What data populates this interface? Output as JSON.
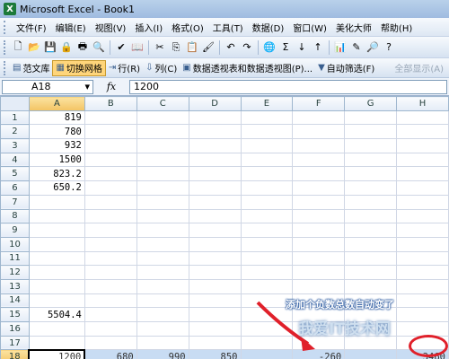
{
  "window": {
    "app_icon": "X",
    "title": "Microsoft Excel - Book1"
  },
  "menu": [
    "文件(F)",
    "编辑(E)",
    "视图(V)",
    "插入(I)",
    "格式(O)",
    "工具(T)",
    "数据(D)",
    "窗口(W)",
    "美化大师",
    "帮助(H)"
  ],
  "toolbar_icons": [
    "new-icon",
    "open-icon",
    "save-icon",
    "permission-icon",
    "print-icon",
    "print-preview-icon",
    "spelling-icon",
    "research-icon",
    "cut-icon",
    "copy-icon",
    "paste-icon",
    "format-painter-icon",
    "undo-icon",
    "redo-icon",
    "hyperlink-icon",
    "autosum-icon",
    "sort-asc-icon",
    "sort-desc-icon",
    "chart-icon",
    "drawing-icon",
    "zoom-icon",
    "help-icon"
  ],
  "toolbar2": {
    "fanwenku": "范文库",
    "toggle_grid": "切换网格",
    "row": "行(R)",
    "col": "列(C)",
    "pivot": "数据透视表和数据透视图(P)...",
    "autofilter": "自动筛选(F)",
    "show_all": "全部显示(A)"
  },
  "formula_bar": {
    "name_box": "A18",
    "fx": "fx",
    "value": "1200"
  },
  "columns": [
    "A",
    "B",
    "C",
    "D",
    "E",
    "F",
    "G",
    "H"
  ],
  "rows": [
    {
      "n": "1",
      "a": "819"
    },
    {
      "n": "2",
      "a": "780"
    },
    {
      "n": "3",
      "a": "932"
    },
    {
      "n": "4",
      "a": "1500"
    },
    {
      "n": "5",
      "a": "823.2"
    },
    {
      "n": "6",
      "a": "650.2"
    },
    {
      "n": "7",
      "a": ""
    },
    {
      "n": "8",
      "a": ""
    },
    {
      "n": "9",
      "a": ""
    },
    {
      "n": "10",
      "a": ""
    },
    {
      "n": "11",
      "a": ""
    },
    {
      "n": "12",
      "a": ""
    },
    {
      "n": "13",
      "a": ""
    },
    {
      "n": "14",
      "a": ""
    },
    {
      "n": "15",
      "a": "5504.4"
    },
    {
      "n": "16",
      "a": ""
    },
    {
      "n": "17",
      "a": ""
    }
  ],
  "selected_row": {
    "n": "18",
    "values": [
      "1200",
      "680",
      "990",
      "850",
      "",
      "-260",
      "",
      "3460"
    ]
  },
  "annotation": "添加个负数总数自动变了",
  "watermark": "我爱IT技术网",
  "colors": {
    "accent": "#e0202a",
    "selection": "#c8dcf3"
  }
}
